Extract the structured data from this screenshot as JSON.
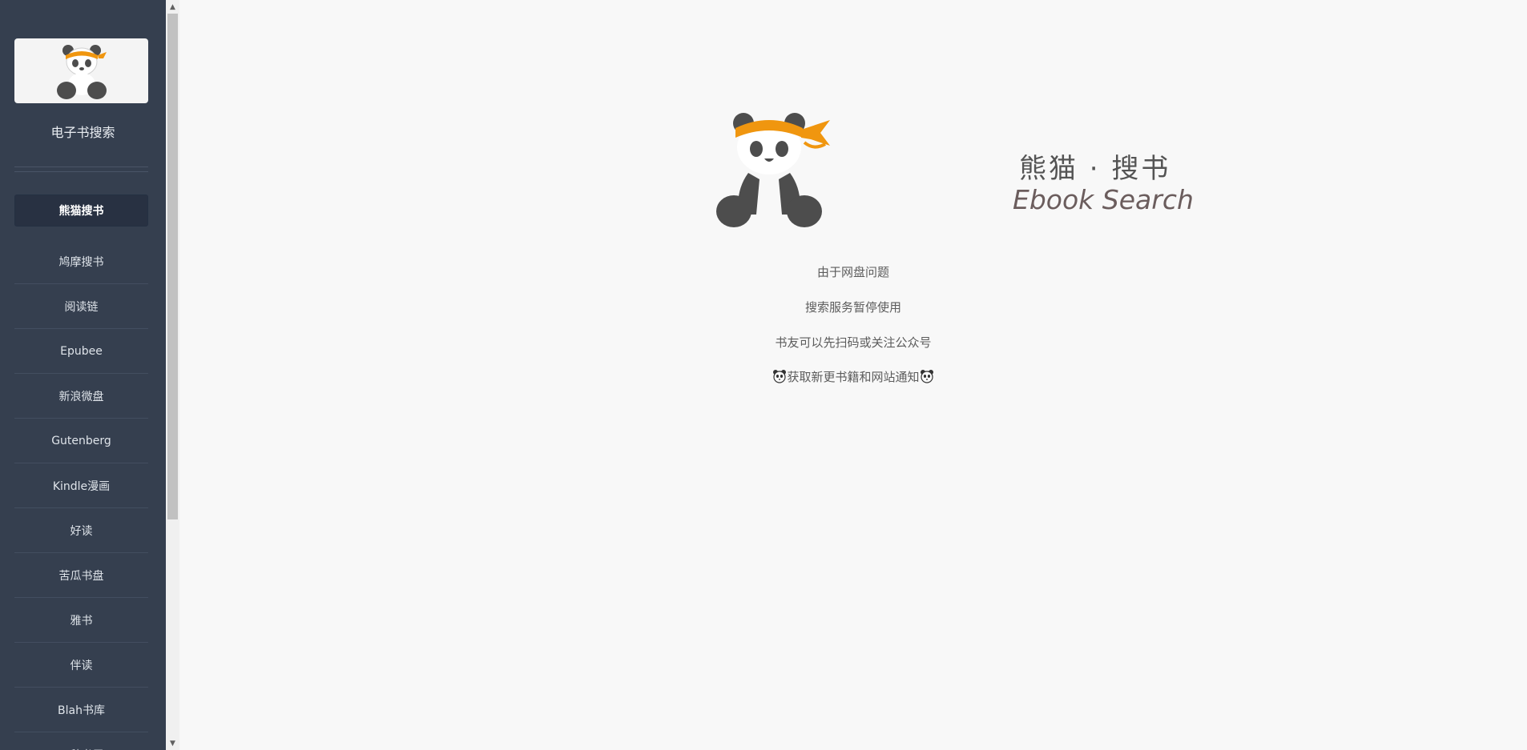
{
  "sidebar": {
    "title": "电子书搜索",
    "items": [
      {
        "label": "熊猫搜书",
        "active": true
      },
      {
        "label": "鸠摩搜书"
      },
      {
        "label": "阅读链"
      },
      {
        "label": "Epubee"
      },
      {
        "label": "新浪微盘"
      },
      {
        "label": "Gutenberg"
      },
      {
        "label": "Kindle漫画"
      },
      {
        "label": "好读"
      },
      {
        "label": "苦瓜书盘"
      },
      {
        "label": "雅书"
      },
      {
        "label": "伴读"
      },
      {
        "label": "Blah书库"
      },
      {
        "label": "三秋书屋"
      }
    ]
  },
  "main": {
    "brand_cn": "熊猫 · 搜书",
    "brand_en": "Ebook Search",
    "messages": [
      "由于网盘问题",
      "搜索服务暂停使用",
      "书友可以先扫码或关注公众号",
      "获取新更书籍和网站通知"
    ]
  },
  "colors": {
    "sidebar_bg": "#353f4f",
    "accent_orange": "#f0960f",
    "panda_gray": "#4d4d4d"
  }
}
